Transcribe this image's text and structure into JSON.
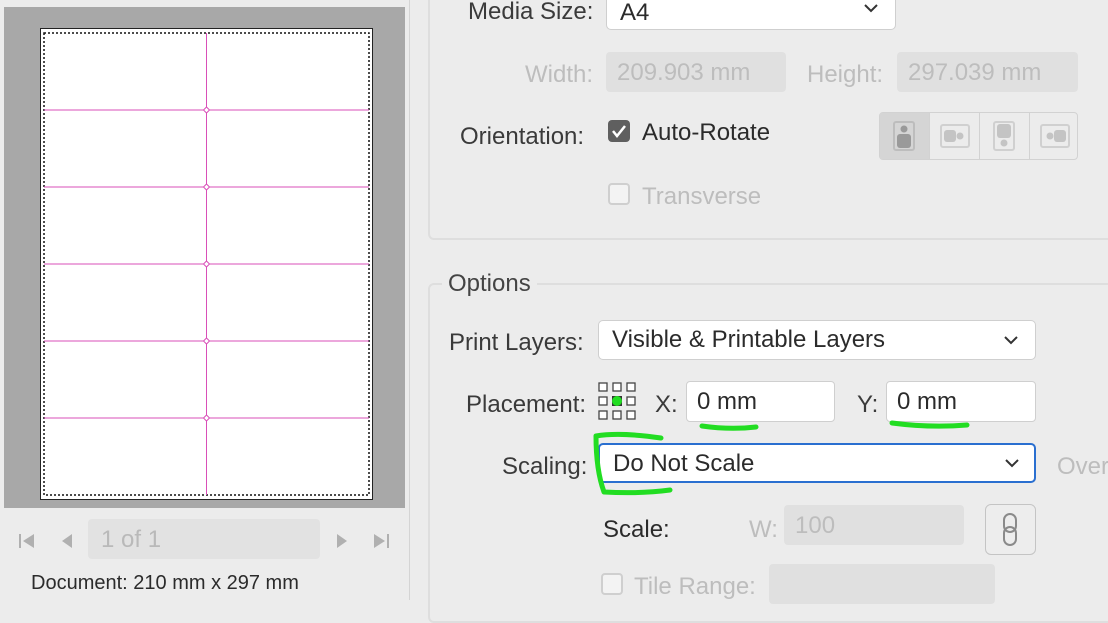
{
  "preview": {
    "grid_rows": 6,
    "grid_columns": 2,
    "page_counter": "1 of 1",
    "document_info": "Document: 210 mm x 297 mm",
    "guide_color": "#d94fb8"
  },
  "media": {
    "size_label": "Media Size:",
    "size_value": "A4",
    "width_label": "Width:",
    "width_value": "209.903 mm",
    "height_label": "Height:",
    "height_value": "297.039 mm",
    "orientation_label": "Orientation:",
    "auto_rotate_label": "Auto-Rotate",
    "auto_rotate_checked": true,
    "transverse_label": "Transverse",
    "transverse_checked": false,
    "orientation_buttons": [
      "portrait",
      "landscape",
      "reverse-portrait",
      "reverse-landscape"
    ]
  },
  "options": {
    "legend": "Options",
    "print_layers_label": "Print Layers:",
    "print_layers_value": "Visible & Printable Layers",
    "placement_label": "Placement:",
    "x_label": "X:",
    "x_value": "0 mm",
    "y_label": "Y:",
    "y_value": "0 mm",
    "scaling_label": "Scaling:",
    "scaling_value": "Do Not Scale",
    "overflow_label": "Over",
    "scale_label": "Scale:",
    "scale_w_label": "W:",
    "scale_w_value": "100",
    "tile_range_label": "Tile Range:",
    "tile_range_checked": false
  },
  "colors": {
    "annotation_green": "#22dd22",
    "focus_blue": "#2a6fd0"
  },
  "icons": {
    "first_page": "first-page-icon",
    "prev_page": "prev-page-icon",
    "next_page": "next-page-icon",
    "last_page": "last-page-icon",
    "checkmark": "checkmark-icon",
    "link": "link-icon",
    "placement_grid": "placement-grid-icon"
  }
}
